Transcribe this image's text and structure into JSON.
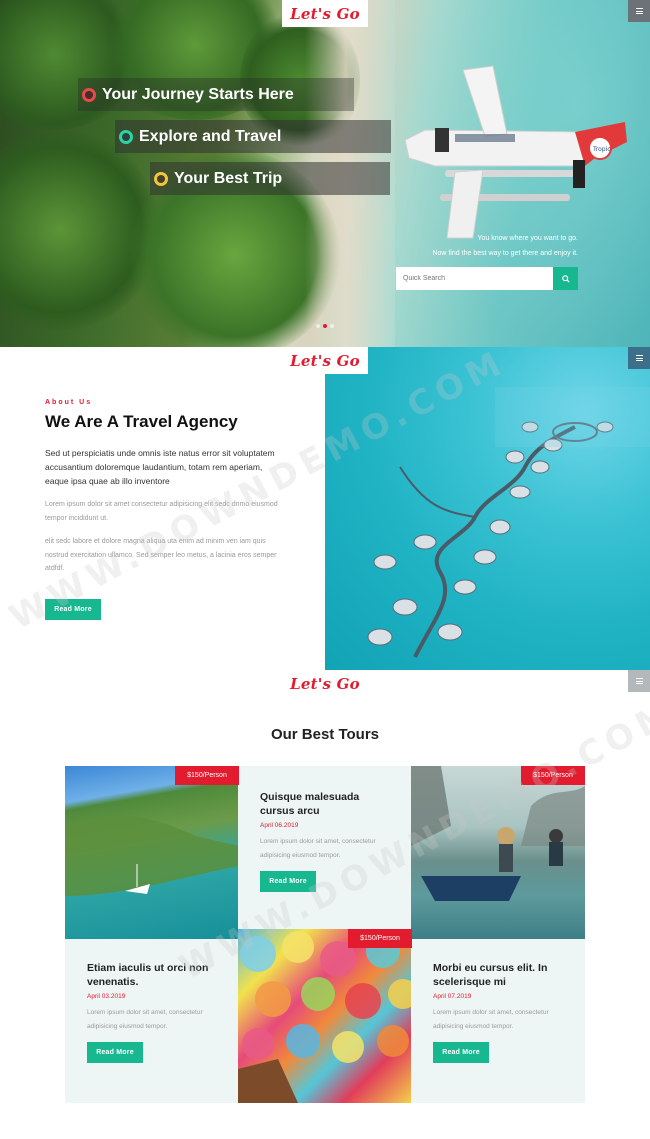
{
  "brand": {
    "logo_text": "Let's Go",
    "accent": "#e21b2e",
    "green": "#17b890"
  },
  "hero": {
    "lines": [
      {
        "text": "Your Journey Starts Here",
        "dot_color": "#e84a4a"
      },
      {
        "text": "Explore and Travel",
        "dot_color": "#2fd3a2"
      },
      {
        "text": "Your Best Trip",
        "dot_color": "#f2c63a"
      }
    ],
    "tagline_1": "You know where you want to go.",
    "tagline_2": "Now find the best way to get there and enjoy it.",
    "search": {
      "placeholder": "Quick Search",
      "button_icon": "search-icon"
    },
    "slider": {
      "count": 3,
      "active_index": 1
    },
    "plane_text": "Tropic"
  },
  "about": {
    "kicker": "About Us",
    "title": "We Are A Travel Agency",
    "lead": "Sed ut perspiciatis unde omnis iste natus error sit voluptatem accusantium doloremque laudantium, totam rem aperiam, eaque ipsa quae ab illo inventore",
    "para_1": "Lorem ipsum dolor sit amet consectetur adipisicing elit sedc dnmo eiusmod tempor incididunt ut.",
    "para_2": "elit sedc labore et dolore magna aliqua uta enim ad minim ven iam quis nostrud exercitation ullamco. Sed semper leo metus, a lacinia eros semper atdfdf.",
    "button": "Read More"
  },
  "tours": {
    "heading": "Our Best Tours",
    "cards": [
      {
        "title": "Etiam iaculis ut orci non venenatis.",
        "date": "April 03.2019",
        "price": "$150/Person",
        "desc": "Lorem ipsum dolor sit amet, consectetur adipisicing eiusmod tempor.",
        "button": "Read More"
      },
      {
        "title": "Quisque malesuada cursus arcu",
        "date": "April 06.2019",
        "price": "$150/Person",
        "desc": "Lorem ipsum dolor sit amet, consectetur adipisicing eiusmod tempor.",
        "button": "Read More"
      },
      {
        "title": "Morbi eu cursus elit. In scelerisque mi",
        "date": "April 07.2019",
        "price": "$150/Person",
        "desc": "Lorem ipsum dolor sit amet, consectetur adipisicing eiusmod tempor.",
        "button": "Read More"
      }
    ]
  },
  "watermark": "WWW.DOWNDEMO.COM"
}
